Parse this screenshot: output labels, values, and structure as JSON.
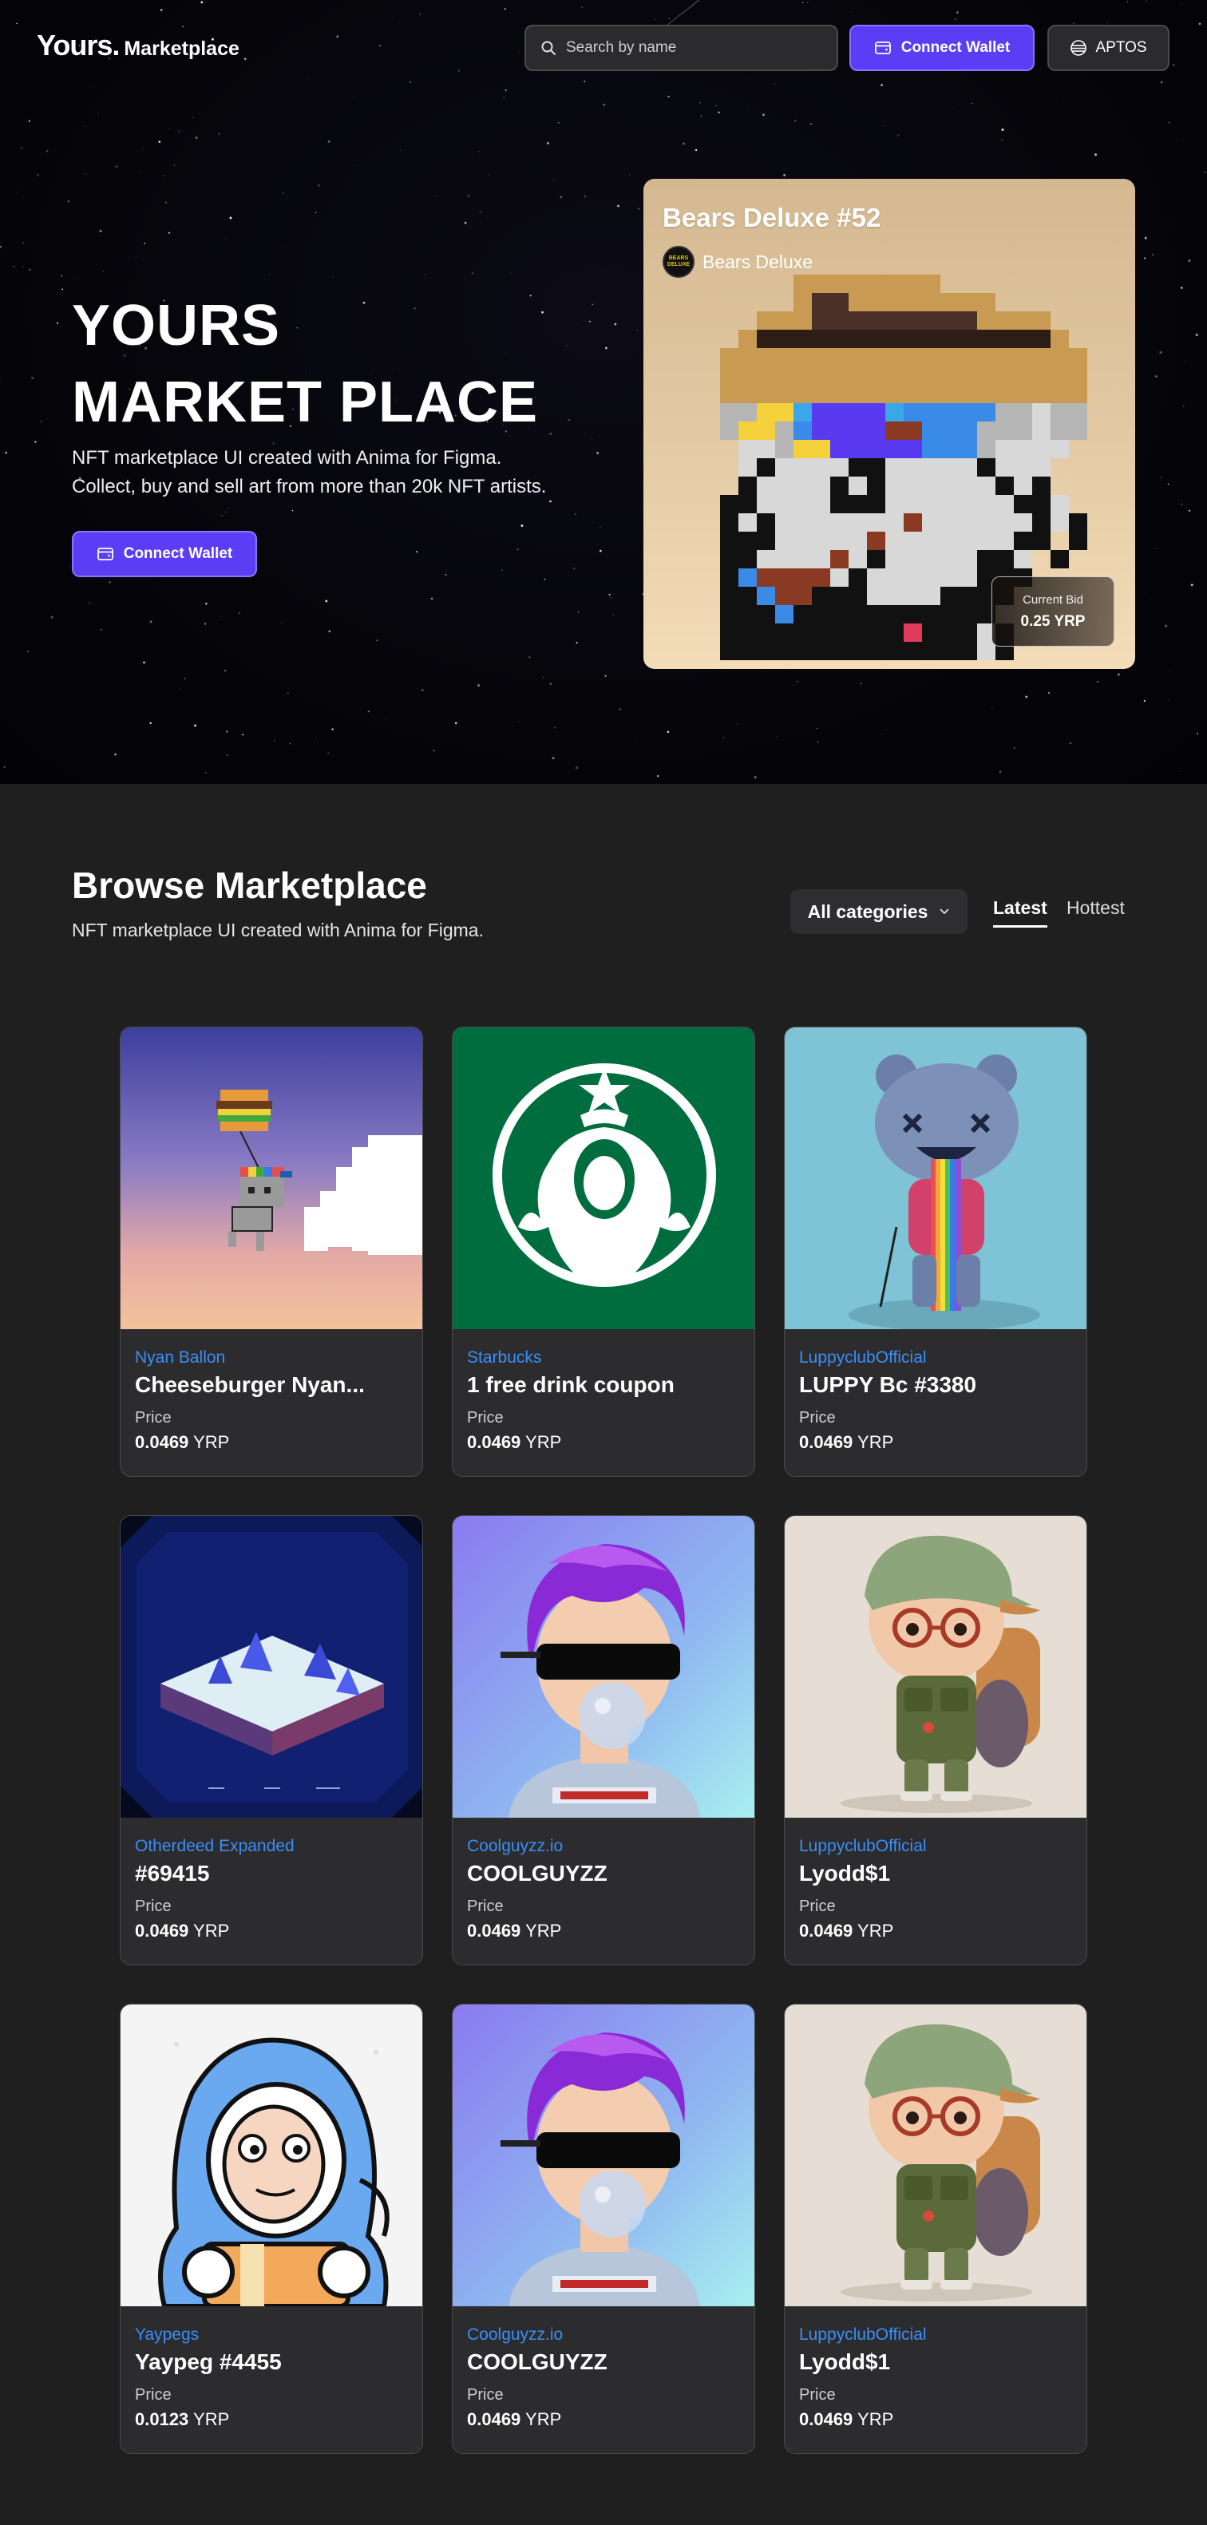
{
  "header": {
    "logo_mark": "Yours.",
    "logo_text": "Marketplace",
    "search_placeholder": "Search by name",
    "connect_label": "Connect Wallet",
    "network_label": "APTOS"
  },
  "hero": {
    "title_line1": "YOURS",
    "title_line2": "MARKET PLACE",
    "subtitle_line1": "NFT marketplace UI created with Anima for Figma.",
    "subtitle_line2": "Collect, buy and sell art from more than 20k NFT artists.",
    "cta_label": "Connect Wallet",
    "featured": {
      "title": "Bears Deluxe #52",
      "owner": "Bears Deluxe",
      "avatar_text": "BEARS DELUXE",
      "bid_label": "Current Bid",
      "bid_value": "0.25 YRP"
    }
  },
  "browse": {
    "title": "Browse Marketplace",
    "subtitle": "NFT marketplace UI created with Anima for Figma.",
    "category_label": "All categories",
    "tabs": [
      {
        "label": "Latest",
        "active": true
      },
      {
        "label": "Hottest",
        "active": false
      }
    ],
    "items": [
      {
        "collection": "Nyan Ballon",
        "name": "Cheeseburger Nyan...",
        "price_label": "Price",
        "price_value": "0.0469",
        "currency": "YRP",
        "art": "nyan"
      },
      {
        "collection": "Starbucks",
        "name": "1 free drink coupon",
        "price_label": "Price",
        "price_value": "0.0469",
        "currency": "YRP",
        "art": "starbucks"
      },
      {
        "collection": "LuppyclubOfficial",
        "name": "LUPPY Bc #3380",
        "price_label": "Price",
        "price_value": "0.0469",
        "currency": "YRP",
        "art": "luppy"
      },
      {
        "collection": "Otherdeed Expanded",
        "name": "#69415",
        "price_label": "Price",
        "price_value": "0.0469",
        "currency": "YRP",
        "art": "otherdeed"
      },
      {
        "collection": "Coolguyzz.io",
        "name": "COOLGUYZZ",
        "price_label": "Price",
        "price_value": "0.0469",
        "currency": "YRP",
        "art": "coolguy"
      },
      {
        "collection": "LuppyclubOfficial",
        "name": "Lyodd$1",
        "price_label": "Price",
        "price_value": "0.0469",
        "currency": "YRP",
        "art": "lyodd"
      },
      {
        "collection": "Yaypegs",
        "name": "Yaypeg #4455",
        "price_label": "Price",
        "price_value": "0.0123",
        "currency": "YRP",
        "art": "yaypeg"
      },
      {
        "collection": "Coolguyzz.io",
        "name": "COOLGUYZZ",
        "price_label": "Price",
        "price_value": "0.0469",
        "currency": "YRP",
        "art": "coolguy"
      },
      {
        "collection": "LuppyclubOfficial",
        "name": "Lyodd$1",
        "price_label": "Price",
        "price_value": "0.0469",
        "currency": "YRP",
        "art": "lyodd"
      }
    ]
  },
  "colors": {
    "accent": "#5b3df5",
    "link": "#3a8ef6",
    "card_bg": "#2c2c2e",
    "page_bg": "#1f1f20"
  }
}
